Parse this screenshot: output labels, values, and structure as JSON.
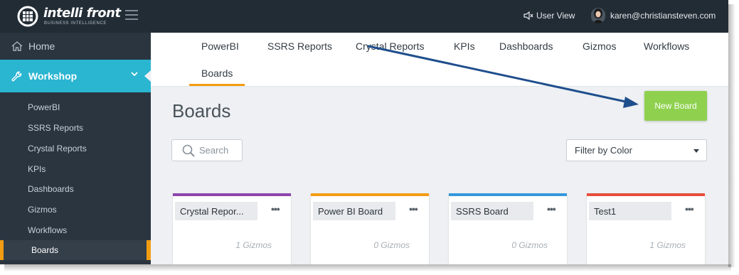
{
  "header": {
    "brand": "intelli front",
    "tagline": "BUSINESS INTELLIGENCE",
    "user_view_label": "User View",
    "user_email": "karen@christiansteven.com"
  },
  "sidebar": {
    "home_label": "Home",
    "workshop_label": "Workshop",
    "items": [
      {
        "label": "PowerBI"
      },
      {
        "label": "SSRS Reports"
      },
      {
        "label": "Crystal Reports"
      },
      {
        "label": "KPIs"
      },
      {
        "label": "Dashboards"
      },
      {
        "label": "Gizmos"
      },
      {
        "label": "Workflows"
      },
      {
        "label": "Boards",
        "active": true
      }
    ]
  },
  "tabs": [
    {
      "label": "PowerBI"
    },
    {
      "label": "SSRS Reports"
    },
    {
      "label": "Crystal Reports"
    },
    {
      "label": "KPIs"
    },
    {
      "label": "Dashboards"
    },
    {
      "label": "Gizmos"
    },
    {
      "label": "Workflows"
    },
    {
      "label": "Boards",
      "active": true
    }
  ],
  "main": {
    "title": "Boards",
    "new_board_label": "New Board",
    "search_placeholder": "Search",
    "filter_label": "Filter by Color"
  },
  "boards": [
    {
      "name": "Crystal Repor...",
      "count": "1 Gizmos",
      "color": "#8e44ad"
    },
    {
      "name": "Power BI Board",
      "count": "0 Gizmos",
      "color": "#f39c12"
    },
    {
      "name": "SSRS Board",
      "count": "0 Gizmos",
      "color": "#3498db"
    },
    {
      "name": "Test1",
      "count": "1 Gizmos",
      "color": "#e74c3c"
    }
  ],
  "colors": {
    "topbar": "#222c35",
    "sidebar": "#2a3540",
    "accent_blue": "#2ab5d1",
    "accent_orange": "#f39c12",
    "new_board_green": "#8fd14f",
    "annotation_arrow": "#1f4e8c"
  }
}
